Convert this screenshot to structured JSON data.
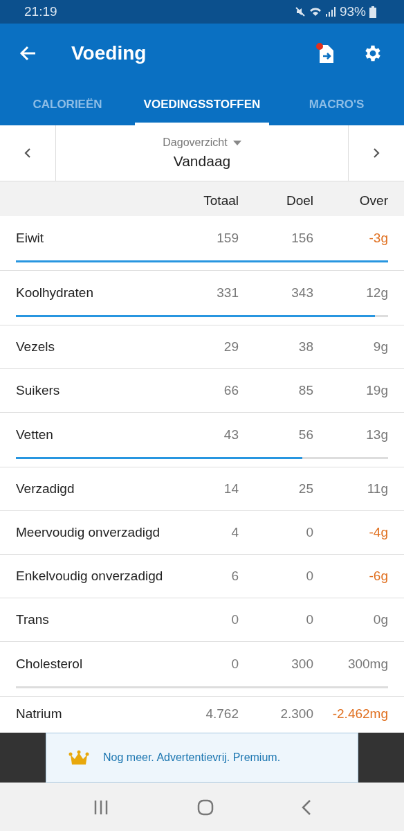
{
  "status_bar": {
    "time": "21:19",
    "battery": "93%"
  },
  "app_bar": {
    "title": "Voeding",
    "export_badge": true
  },
  "tabs": [
    {
      "label": "CALORIEËN",
      "selected": false
    },
    {
      "label": "VOEDINGSSTOFFEN",
      "selected": true
    },
    {
      "label": "MACRO'S",
      "selected": false
    }
  ],
  "date_nav": {
    "caption": "Dagoverzicht",
    "value": "Vandaag"
  },
  "table": {
    "columns": [
      "Totaal",
      "Doel",
      "Over"
    ],
    "rows": [
      {
        "name": "Eiwit",
        "total": "159",
        "goal": "156",
        "over": "-3g",
        "exceeded": true,
        "kind": "bar",
        "level": 1.0
      },
      {
        "name": "Koolhydraten",
        "total": "331",
        "goal": "343",
        "over": "12g",
        "exceeded": false,
        "kind": "bar",
        "level": 0.965
      },
      {
        "name": "Vezels",
        "total": "29",
        "goal": "38",
        "over": "9g",
        "exceeded": false,
        "kind": "plain"
      },
      {
        "name": "Suikers",
        "total": "66",
        "goal": "85",
        "over": "19g",
        "exceeded": false,
        "kind": "plain"
      },
      {
        "name": "Vetten",
        "total": "43",
        "goal": "56",
        "over": "13g",
        "exceeded": false,
        "kind": "bar",
        "level": 0.77
      },
      {
        "name": "Verzadigd",
        "total": "14",
        "goal": "25",
        "over": "11g",
        "exceeded": false,
        "kind": "plain"
      },
      {
        "name": "Meervoudig onverzadigd",
        "total": "4",
        "goal": "0",
        "over": "-4g",
        "exceeded": true,
        "kind": "plain"
      },
      {
        "name": "Enkelvoudig onverzadigd",
        "total": "6",
        "goal": "0",
        "over": "-6g",
        "exceeded": true,
        "kind": "plain"
      },
      {
        "name": "Trans",
        "total": "0",
        "goal": "0",
        "over": "0g",
        "exceeded": false,
        "kind": "plain"
      },
      {
        "name": "Cholesterol",
        "total": "0",
        "goal": "300",
        "over": "300mg",
        "exceeded": false,
        "kind": "bar",
        "level": 0
      },
      {
        "name": "Natrium",
        "total": "4.762",
        "goal": "2.300",
        "over": "-2.462mg",
        "exceeded": true,
        "kind": "plain"
      }
    ]
  },
  "ad": {
    "text": "Nog meer. Advertentievrij. Premium."
  }
}
